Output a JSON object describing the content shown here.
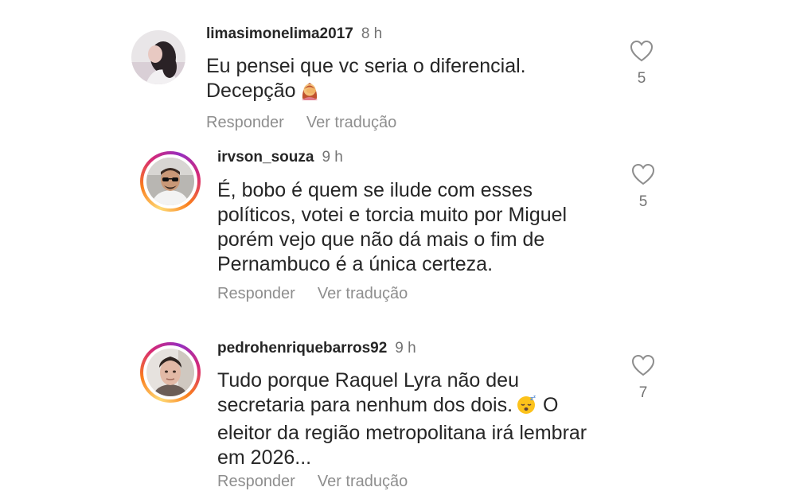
{
  "comments": [
    {
      "username": "limasimonelima2017",
      "time": "8 h",
      "lines": [
        "Eu pensei que vc seria o diferencial.",
        "Decepção"
      ],
      "emoji": "woman-facepalming-emoji",
      "likes": "5",
      "reply_label": "Responder",
      "translate_label": "Ver tradução"
    },
    {
      "username": "irvson_souza",
      "time": "9 h",
      "lines": [
        "É, bobo é quem se ilude com esses",
        "políticos, votei e torcia muito por Miguel",
        "porém vejo que não dá mais o fim de",
        "Pernambuco é a única certeza."
      ],
      "likes": "5",
      "reply_label": "Responder",
      "translate_label": "Ver tradução"
    },
    {
      "username": "pedrohenriquebarros92",
      "time": "9 h",
      "lines": [
        "Tudo porque Raquel Lyra não deu",
        "secretaria para nenhum dos dois.",
        "eleitor da região metropolitana irá lembrar",
        "em 2026..."
      ],
      "line2_suffix": "O",
      "emoji": "sleeping-face-emoji",
      "likes": "7",
      "reply_label": "Responder",
      "translate_label": "Ver tradução"
    }
  ],
  "icons": {
    "like": "heart-outline-icon"
  },
  "colors": {
    "text": "#262626",
    "secondary": "#8e8e8e",
    "time": "#737373",
    "story_ring": [
      "#feda75",
      "#fa7e1e",
      "#d62976",
      "#962fbf"
    ]
  }
}
